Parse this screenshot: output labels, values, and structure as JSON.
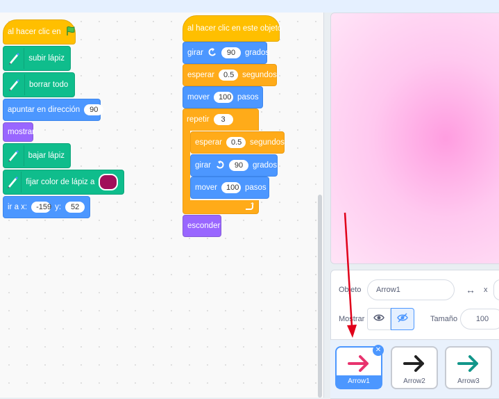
{
  "left_script": {
    "hat": "al hacer clic en",
    "pen_up": "subir lápiz",
    "clear": "borrar todo",
    "point_dir_label": "apuntar en dirección",
    "point_dir_value": "90",
    "show": "mostrar",
    "pen_down": "bajar lápiz",
    "set_pen_color": "fijar color de lápiz a",
    "goto_label": "ir a x:",
    "goto_x": "-159",
    "goto_y_label": "y:",
    "goto_y": "52"
  },
  "right_script": {
    "hat": "al hacer clic en este objeto",
    "turn_left": "girar",
    "turn_left_value": "90",
    "degrees": "grados",
    "wait": "esperar",
    "wait_value": "0.5",
    "seconds": "segundos",
    "move": "mover",
    "move_value": "100",
    "steps": "pasos",
    "repeat": "repetir",
    "repeat_value": "3",
    "inner_wait_value": "0.5",
    "turn_right_value": "90",
    "inner_move_value": "100",
    "hide": "esconder"
  },
  "sprite_info": {
    "object_label": "Objeto",
    "object_name": "Arrow1",
    "x_label": "x",
    "show_label": "Mostrar",
    "size_label": "Tamaño",
    "size_value": "100"
  },
  "sprites": [
    {
      "name": "Arrow1",
      "color": "#e8336e"
    },
    {
      "name": "Arrow2",
      "color": "#222222"
    },
    {
      "name": "Arrow3",
      "color": "#12968a"
    }
  ],
  "colors": {
    "pen_color": "#a10e5a",
    "annotation_arrow": "#e0001a"
  }
}
